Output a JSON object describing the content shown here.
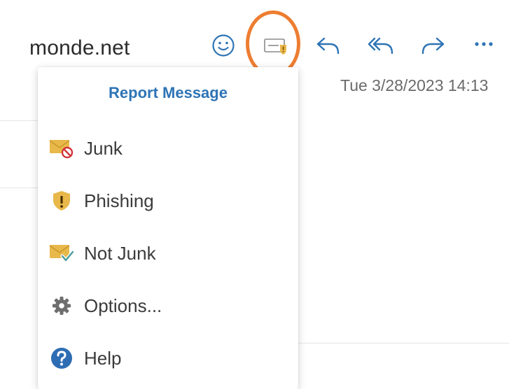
{
  "header": {
    "sender": "monde.net",
    "timestamp": "Tue 3/28/2023 14:13"
  },
  "toolbar": {
    "buttons": [
      {
        "name": "emoji-reaction",
        "icon": "smiley-icon"
      },
      {
        "name": "report-message",
        "icon": "report-icon"
      },
      {
        "name": "reply",
        "icon": "reply-icon"
      },
      {
        "name": "reply-all",
        "icon": "reply-all-icon"
      },
      {
        "name": "forward",
        "icon": "forward-icon"
      },
      {
        "name": "more-actions",
        "icon": "ellipsis-icon"
      }
    ]
  },
  "menu": {
    "title": "Report Message",
    "items": [
      {
        "label": "Junk",
        "icon": "junk-envelope-icon"
      },
      {
        "label": "Phishing",
        "icon": "phishing-shield-icon"
      },
      {
        "label": "Not Junk",
        "icon": "not-junk-envelope-icon"
      },
      {
        "label": "Options...",
        "icon": "gear-icon"
      },
      {
        "label": "Help",
        "icon": "help-icon"
      }
    ]
  },
  "colors": {
    "accent_blue": "#2e74b5",
    "highlight_orange": "#ED7D31",
    "icon_yellow": "#E8B84A"
  }
}
